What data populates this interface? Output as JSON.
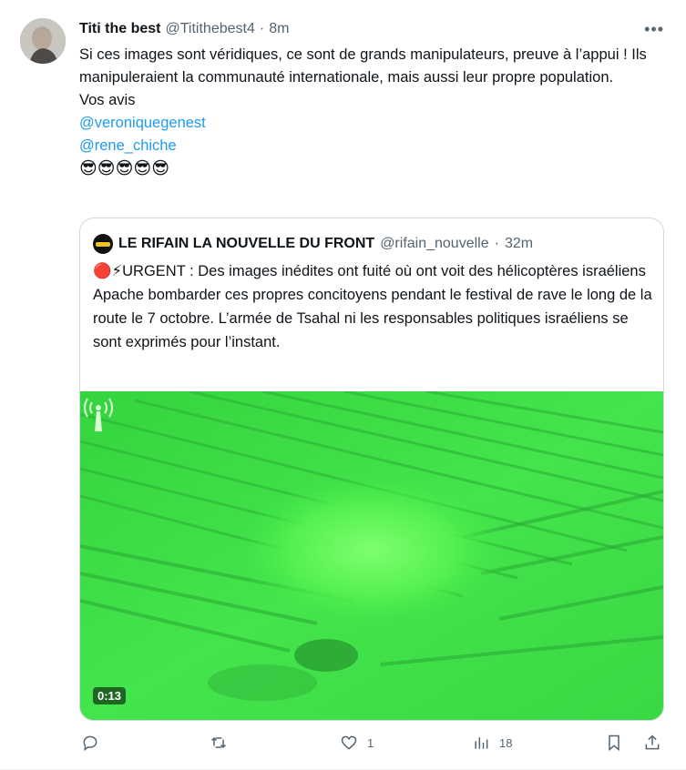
{
  "tweet": {
    "author_name": "Titi the best",
    "author_handle": "@Titithebest4",
    "separator": "·",
    "time": "8m",
    "more_icon": "more-horizontal-icon",
    "text_line1": "Si ces images sont véridiques, ce sont de grands manipulateurs, preuve à l’appui ! Ils manipuleraient la communauté internationale, mais aussi leur propre population.",
    "text_line2": "Vos avis",
    "mention1": "@veroniquegenest",
    "mention2": "@rene_chiche",
    "emojis": "😎😎😎😎😎"
  },
  "quote": {
    "author_name": "LE RIFAIN LA NOUVELLE DU FRONT",
    "author_handle": "@rifain_nouvelle",
    "separator": "·",
    "time": "32m",
    "text": "🔴⚡URGENT : Des images inédites ont fuité où ont voit des hélicoptères israéliens Apache bombarder ces propres concitoyens pendant le festival de rave le long de la route le 7 octobre. L’armée de Tsahal ni les responsables politiques israéliens se sont exprimés pour l’instant.",
    "video_duration": "0:13"
  },
  "actions": {
    "reply_count": "",
    "retweet_count": "",
    "like_count": "1",
    "views_count": "18"
  },
  "colors": {
    "link": "#1d9bf0",
    "muted": "#536471",
    "video_green": "#3ee84a"
  }
}
